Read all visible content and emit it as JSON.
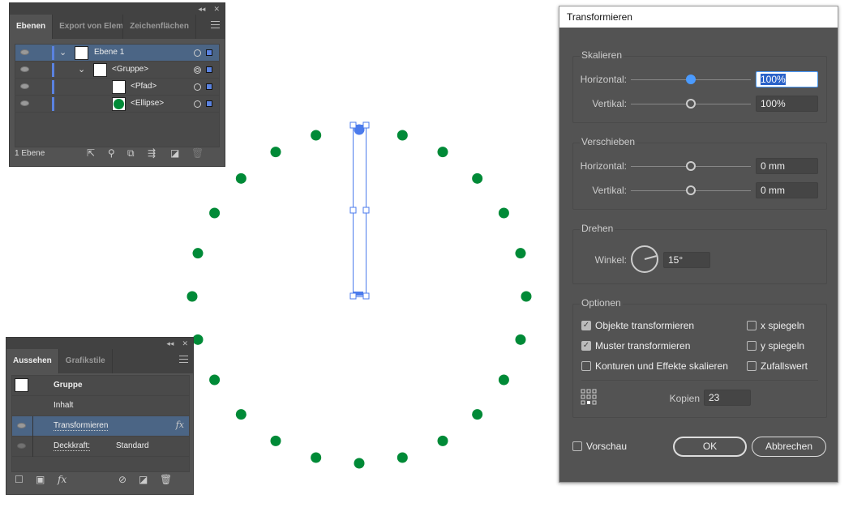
{
  "layers_panel": {
    "tabs": [
      "Ebenen",
      "Export von Elemen",
      "Zeichenflächen"
    ],
    "rows": [
      {
        "label": "Ebene 1",
        "selected": true
      },
      {
        "label": "<Gruppe>"
      },
      {
        "label": "<Pfad>"
      },
      {
        "label": "<Ellipse>"
      }
    ],
    "footer": "1 Ebene",
    "icons": [
      "export-icon",
      "search-icon",
      "clip-mask-icon",
      "new-sublayer-icon",
      "new-layer-icon",
      "trash-icon"
    ]
  },
  "appearance_panel": {
    "tabs": [
      "Aussehen",
      "Grafikstile"
    ],
    "rows": {
      "group": "Gruppe",
      "content": "Inhalt",
      "effect": "Transformieren",
      "fx": "fx",
      "opacity_label": "Deckkraft:",
      "opacity_value": "Standard"
    },
    "footer_fx": "fx"
  },
  "canvas": {
    "dot_count": 24,
    "dot_color": "#008a37",
    "selection_color": "#4b7bec"
  },
  "dialog": {
    "title": "Transformieren",
    "scale": {
      "legend": "Skalieren",
      "h_label": "Horizontal:",
      "h_value": "100%",
      "v_label": "Vertikal:",
      "v_value": "100%"
    },
    "move": {
      "legend": "Verschieben",
      "h_label": "Horizontal:",
      "h_value": "0 mm",
      "v_label": "Vertikal:",
      "v_value": "0 mm"
    },
    "rotate": {
      "legend": "Drehen",
      "angle_label": "Winkel:",
      "angle_value": "15°",
      "angle_deg": 15
    },
    "options": {
      "legend": "Optionen",
      "objects": "Objekte transformieren",
      "objects_checked": true,
      "patterns": "Muster transformieren",
      "patterns_checked": true,
      "strokes": "Konturen und Effekte skalieren",
      "strokes_checked": false,
      "flip_x": "x spiegeln",
      "flip_y": "y spiegeln",
      "random": "Zufallswert",
      "copies_label": "Kopien",
      "copies_value": "23"
    },
    "preview": "Vorschau",
    "ok": "OK",
    "cancel": "Abbrechen"
  }
}
